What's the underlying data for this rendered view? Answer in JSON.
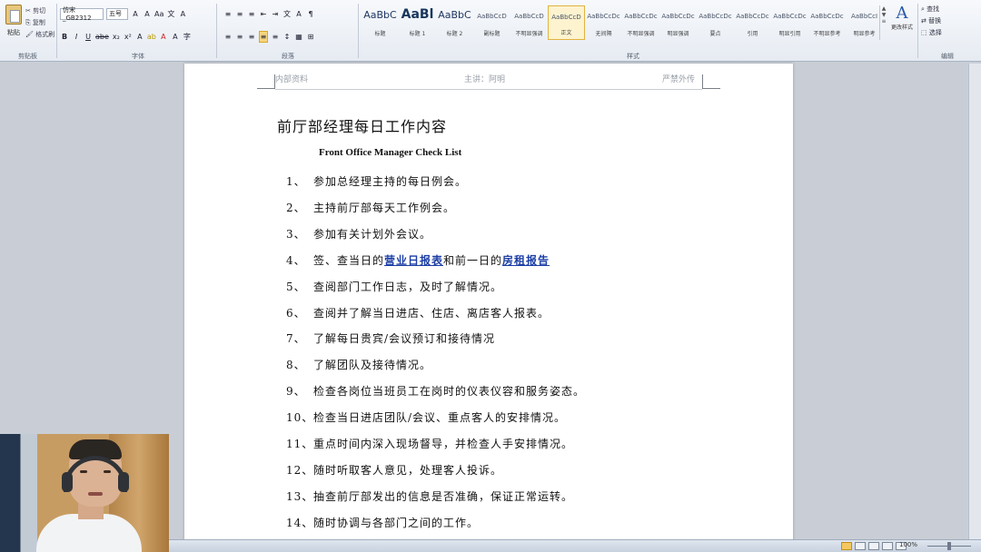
{
  "ribbon": {
    "clipboard": {
      "paste_label": "粘贴",
      "cut": "剪切",
      "copy": "复制",
      "format_painter": "格式刷",
      "group_label": "剪贴板"
    },
    "font": {
      "name": "仿宋_GB2312",
      "size": "五号",
      "group_label": "字体",
      "row1": [
        "A",
        "A",
        "Aa",
        "文",
        "A"
      ],
      "row2": [
        "B",
        "I",
        "U",
        "abe",
        "x₂",
        "x²",
        "A",
        "ab",
        "A",
        "A",
        "字"
      ]
    },
    "paragraph": {
      "group_label": "段落",
      "row1": [
        "≡",
        "≡",
        "≡",
        "⇤",
        "⇥",
        "文",
        "A",
        "¶"
      ],
      "row2": [
        "≡",
        "≡",
        "≡",
        "≡",
        "≡",
        "↕",
        "▦",
        "⊞"
      ]
    },
    "styles": {
      "group_label": "样式",
      "items": [
        {
          "sample": "AaBbC",
          "name": "标题",
          "kind": "mid"
        },
        {
          "sample": "AaBl",
          "name": "标题 1",
          "kind": "big"
        },
        {
          "sample": "AaBbC",
          "name": "标题 2",
          "kind": "mid"
        },
        {
          "sample": "AaBbCcD",
          "name": "副标题",
          "kind": "tiny"
        },
        {
          "sample": "AaBbCcD",
          "name": "不明显强调",
          "kind": "tiny"
        },
        {
          "sample": "AaBbCcD",
          "name": "正文",
          "kind": "tiny",
          "active": true
        },
        {
          "sample": "AaBbCcDc",
          "name": "无间隔",
          "kind": "tiny"
        },
        {
          "sample": "AaBbCcDc",
          "name": "不明显强调",
          "kind": "tiny"
        },
        {
          "sample": "AaBbCcDc",
          "name": "明显强调",
          "kind": "tiny"
        },
        {
          "sample": "AaBbCcDc",
          "name": "要点",
          "kind": "tiny"
        },
        {
          "sample": "AaBbCcDc",
          "name": "引用",
          "kind": "tiny"
        },
        {
          "sample": "AaBbCcDc",
          "name": "明显引用",
          "kind": "tiny"
        },
        {
          "sample": "AaBbCcDc",
          "name": "不明显参考",
          "kind": "tiny"
        },
        {
          "sample": "AaBbCcI",
          "name": "明显参考",
          "kind": "tiny"
        }
      ],
      "change_styles": "更改样式"
    },
    "editing": {
      "group_label": "编辑",
      "find": "查找",
      "replace": "替换",
      "select": "选择"
    }
  },
  "document": {
    "header": {
      "left": "内部资料",
      "center": "主讲：阿明",
      "right": "严禁外传"
    },
    "title": "前厅部经理每日工作内容",
    "subtitle": "Front Office Manager Check List",
    "items": [
      {
        "num": "1、",
        "text": "参加总经理主持的每日例会。"
      },
      {
        "num": "2、",
        "text": "主持前厅部每天工作例会。"
      },
      {
        "num": "3、",
        "text": "参加有关计划外会议。"
      },
      {
        "num": "4、",
        "pre": "签、查当日的",
        "link1": "营业日报表",
        "mid": "和前一日的",
        "link2": "房租报告",
        "post": ""
      },
      {
        "num": "5、",
        "text": "查阅部门工作日志，及时了解情况。"
      },
      {
        "num": "6、",
        "text": "查阅并了解当日进店、住店、离店客人报表。"
      },
      {
        "num": "7、",
        "text": "了解每日贵宾/会议预订和接待情况"
      },
      {
        "num": "8、",
        "text": "了解团队及接待情况。"
      },
      {
        "num": "9、",
        "text": "检查各岗位当班员工在岗时的仪表仪容和服务姿态。"
      },
      {
        "num": "10、",
        "text": "检查当日进店团队/会议、重点客人的安排情况。"
      },
      {
        "num": "11、",
        "text": "重点时间内深入现场督导，并检查人手安排情况。"
      },
      {
        "num": "12、",
        "text": "随时听取客人意见，处理客人投诉。"
      },
      {
        "num": "13、",
        "text": "抽查前厅部发出的信息是否准确，保证正常运转。"
      },
      {
        "num": "14、",
        "text": "随时协调与各部门之间的工作。"
      }
    ]
  },
  "status": {
    "zoom": "100%"
  }
}
